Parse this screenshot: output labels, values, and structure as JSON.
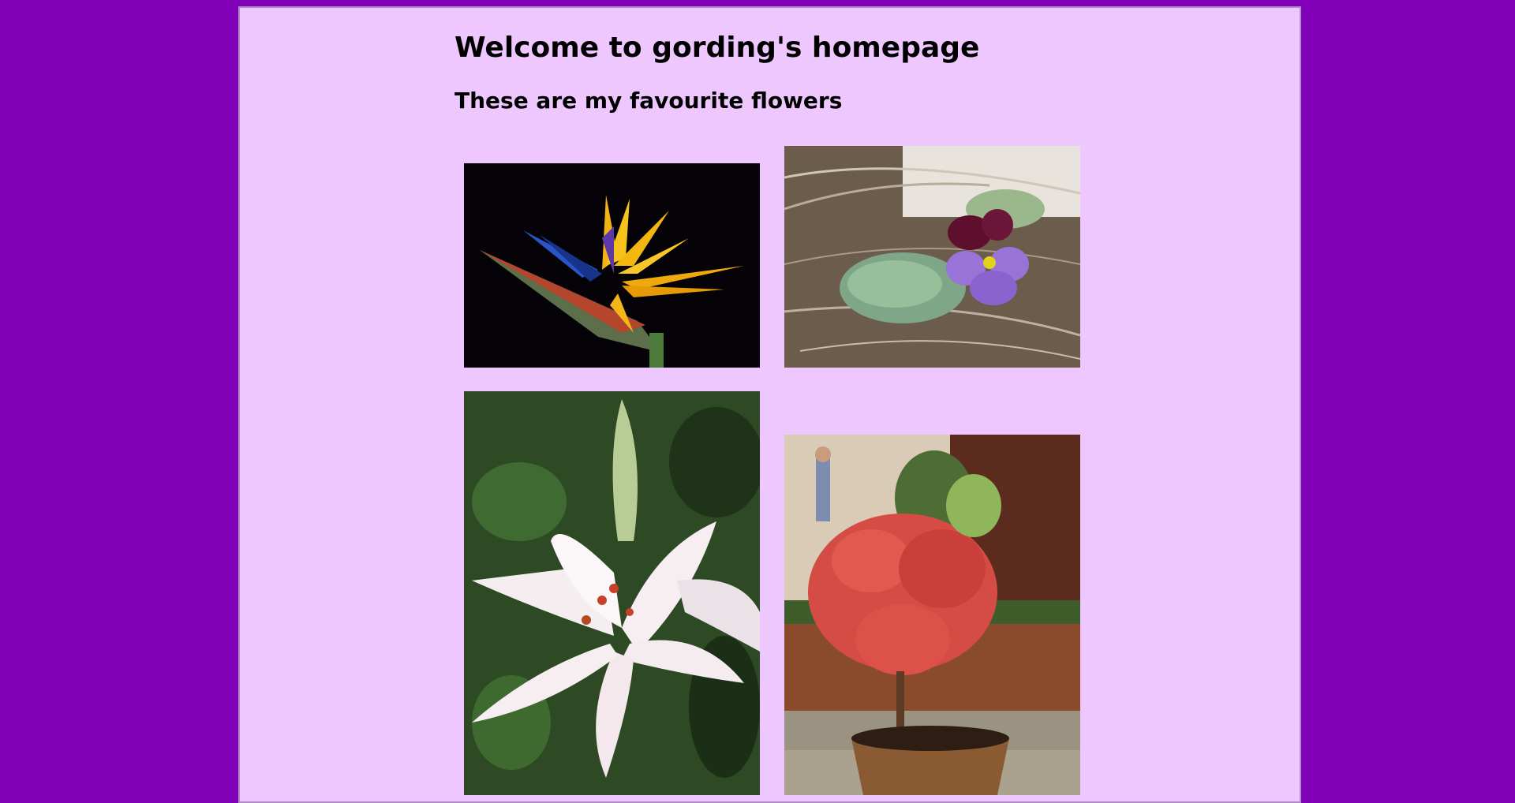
{
  "heading": "Welcome to gording's homepage",
  "subheading": "These are my favourite flowers",
  "photos": [
    {
      "icon": "bird-of-paradise-flower-photo"
    },
    {
      "icon": "violet-pansy-flower-photo"
    },
    {
      "icon": "white-lily-flower-photo"
    },
    {
      "icon": "red-azalea-in-tub-photo"
    }
  ],
  "colors": {
    "background": "#8000b8",
    "panel": "#efc7ff",
    "text": "#000000"
  }
}
